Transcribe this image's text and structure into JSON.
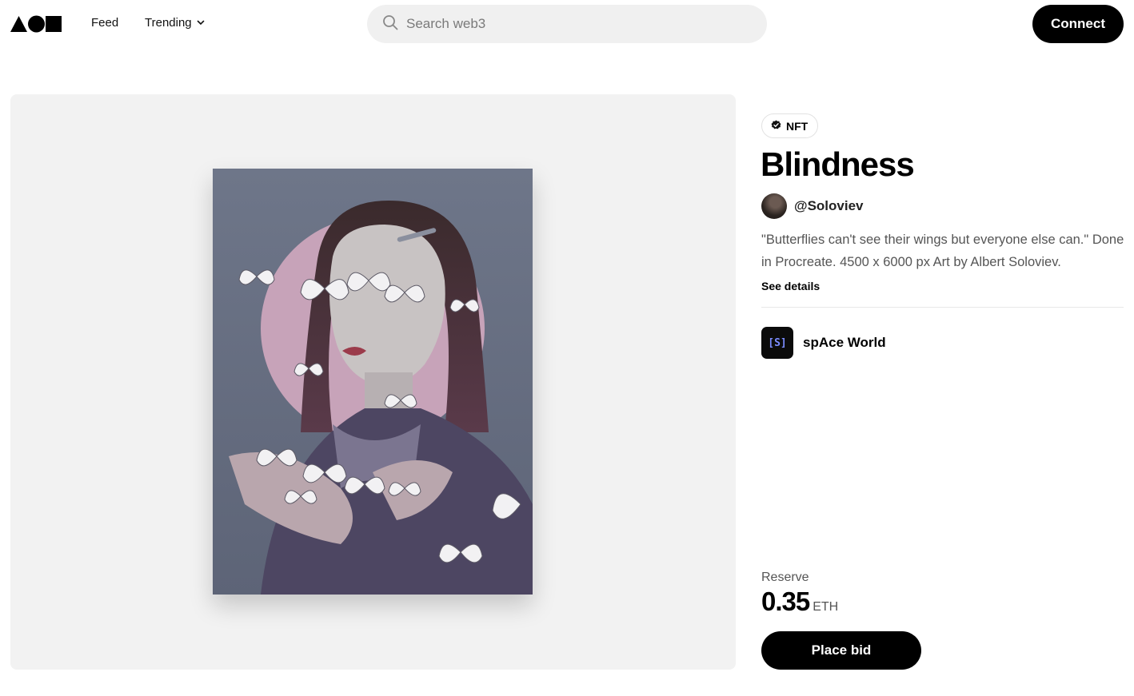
{
  "header": {
    "nav": [
      {
        "label": "Feed"
      },
      {
        "label": "Trending"
      }
    ],
    "search": {
      "placeholder": "Search web3",
      "value": ""
    },
    "connect_label": "Connect"
  },
  "nft": {
    "badge_label": "NFT",
    "title": "Blindness",
    "creator": "@Soloviev",
    "description": "\"Butterflies can't see their wings but everyone else can.\" Done in Procreate. 4500 x 6000 px Art by Albert Soloviev.",
    "see_details_label": "See details",
    "collection": {
      "name": "spAce World",
      "logo_text": "[S]"
    },
    "reserve": {
      "label": "Reserve",
      "amount": "0.35",
      "unit": "ETH"
    },
    "bid_label": "Place bid"
  },
  "colors": {
    "primary": "#000000",
    "panel_background": "#f2f2f2",
    "search_background": "#f0f0f0"
  },
  "icons": {
    "logo": "triangle-circle-square-logo",
    "dropdown": "chevron-down-icon",
    "search": "search-icon",
    "verified": "verified-check-icon"
  }
}
